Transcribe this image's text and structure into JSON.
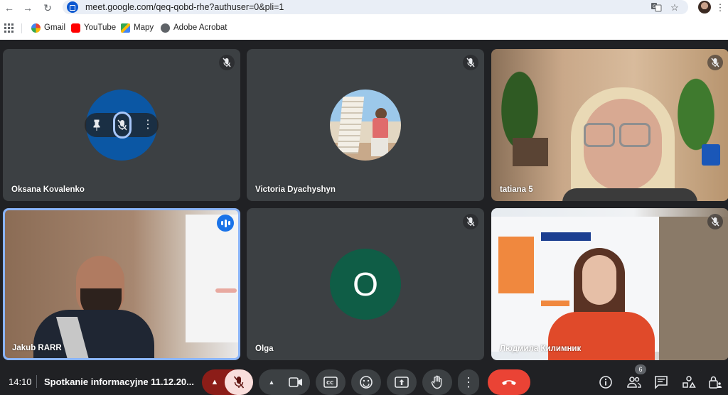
{
  "browser": {
    "url": "meet.google.com/qeq-qobd-rhe?authuser=0&pli=1",
    "bookmarks": [
      {
        "label": "Gmail",
        "icon": "google-icon"
      },
      {
        "label": "YouTube",
        "icon": "youtube-icon"
      },
      {
        "label": "Mapy",
        "icon": "maps-icon"
      },
      {
        "label": "Adobe Acrobat",
        "icon": "acrobat-icon"
      }
    ]
  },
  "participants": [
    {
      "name": "Oksana Kovalenko",
      "muted": true,
      "type": "avatar",
      "hover_controls": true
    },
    {
      "name": "Victoria Dyachyshyn",
      "muted": true,
      "type": "photo-avatar"
    },
    {
      "name": "tatiana 5",
      "muted": true,
      "type": "video"
    },
    {
      "name": "Jakub RARR",
      "muted": false,
      "speaking": true,
      "type": "video"
    },
    {
      "name": "Olga",
      "initial": "O",
      "muted": true,
      "type": "avatar"
    },
    {
      "name": "Людмила Килимник",
      "muted": true,
      "type": "video"
    }
  ],
  "meeting": {
    "time": "14:10",
    "title": "Spotkanie informacyjne 11.12.20..."
  },
  "people_count": "6",
  "colors": {
    "background": "#202124",
    "tile": "#3c4043",
    "end_call": "#ea4335",
    "mic_off": "#f9dedc",
    "speaking_border": "#8ab4f8",
    "olga_avatar": "#0f5d46",
    "oksana_avatar": "#0b57a4"
  }
}
